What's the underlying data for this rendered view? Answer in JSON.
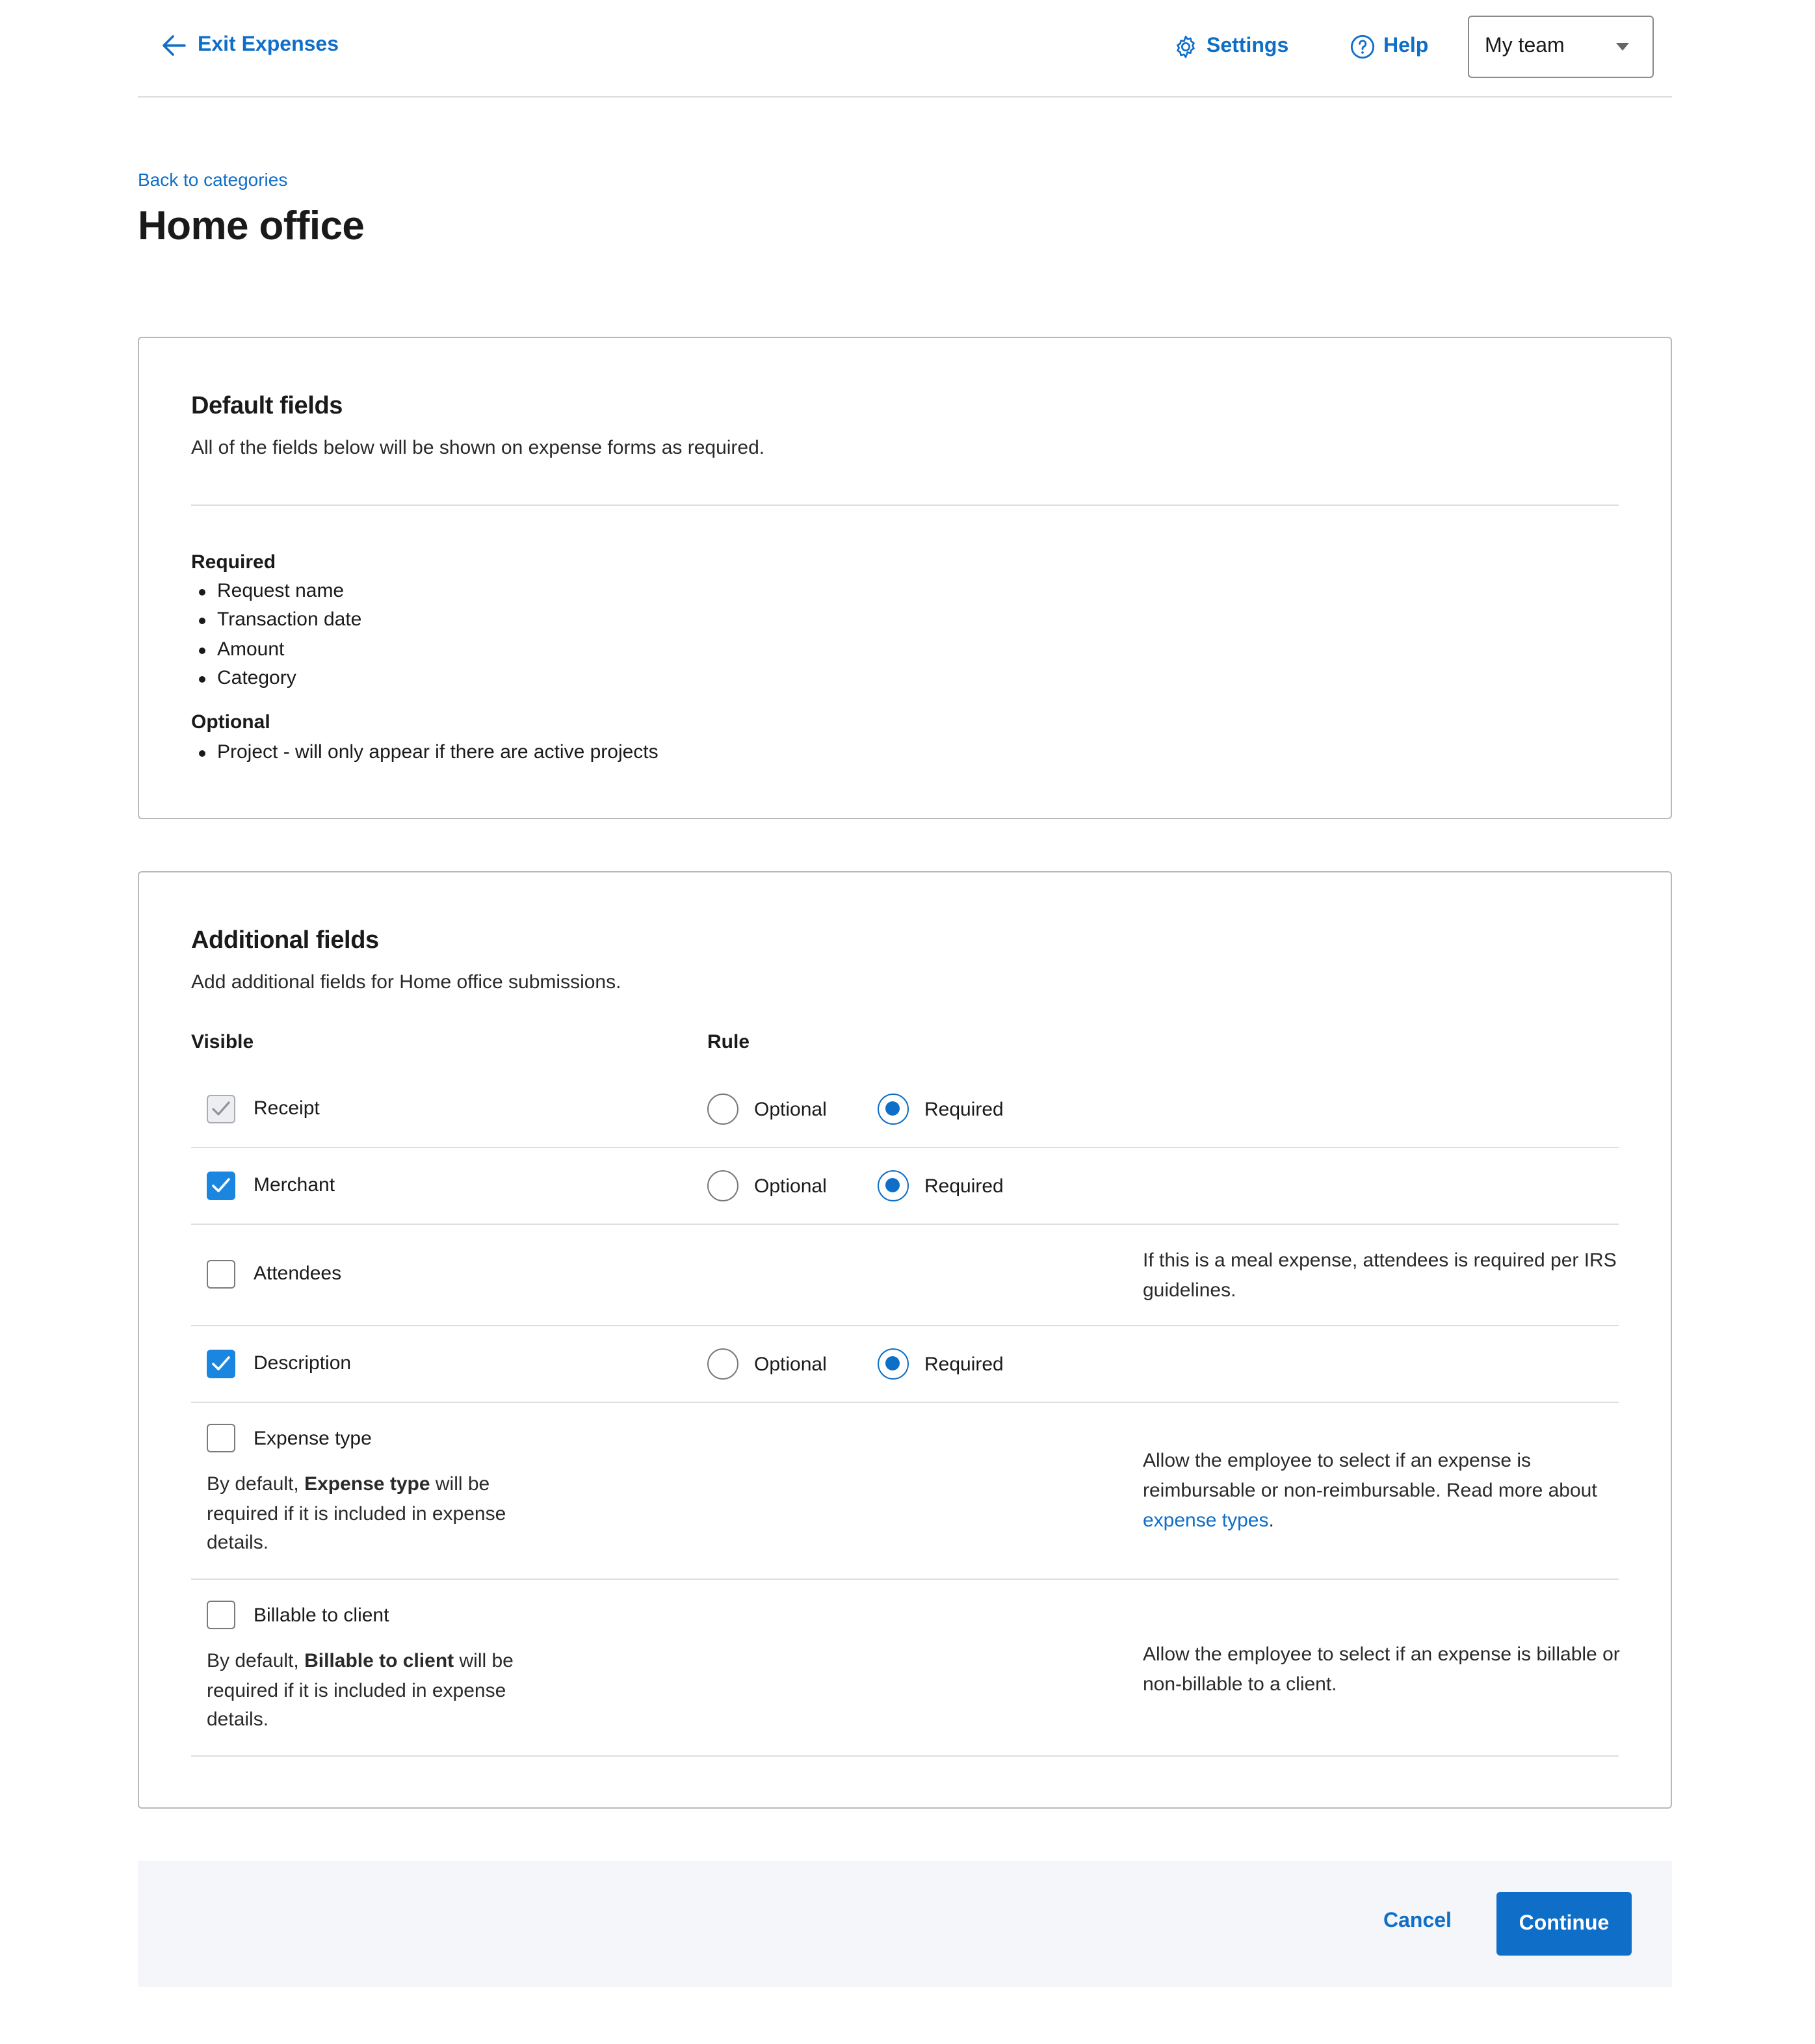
{
  "header": {
    "exit_label": "Exit Expenses",
    "settings_label": "Settings",
    "help_label": "Help",
    "team_select_value": "My team"
  },
  "page": {
    "back_link": "Back to categories",
    "title": "Home office"
  },
  "default_fields": {
    "title": "Default fields",
    "description": "All of the fields below will be shown on expense forms as required.",
    "required_title": "Required",
    "required_items": [
      "Request name",
      "Transaction date",
      "Amount",
      "Category"
    ],
    "optional_title": "Optional",
    "optional_items": [
      "Project - will only appear if there are active projects"
    ]
  },
  "additional_fields": {
    "title": "Additional fields",
    "description": "Add additional fields for Home office submissions.",
    "col_visible": "Visible",
    "col_rule": "Rule",
    "optional_label": "Optional",
    "required_label": "Required",
    "rows": [
      {
        "label": "Receipt",
        "visible": true,
        "disabled": true,
        "rule": "Required"
      },
      {
        "label": "Merchant",
        "visible": true,
        "disabled": false,
        "rule": "Required"
      },
      {
        "label": "Attendees",
        "visible": false,
        "disabled": false,
        "note": "If this is a meal expense, attendees is required per IRS guidelines."
      },
      {
        "label": "Description",
        "visible": true,
        "disabled": false,
        "rule": "Required"
      },
      {
        "label": "Expense type",
        "visible": false,
        "disabled": false,
        "sub_pre": "By default, ",
        "sub_bold": "Expense type",
        "sub_post": " will be required if it is included in expense details.",
        "note_pre": "Allow the employee to select if an expense is reimbursable or non-reimbursable. Read more about ",
        "note_link": "expense types",
        "note_post": "."
      },
      {
        "label": "Billable to client",
        "visible": false,
        "disabled": false,
        "sub_pre": "By default, ",
        "sub_bold": "Billable to client",
        "sub_post": " will be required if it is included in expense details.",
        "note": "Allow the employee to select if an expense is billable or non-billable to a client."
      }
    ]
  },
  "footer": {
    "cancel_label": "Cancel",
    "continue_label": "Continue"
  },
  "colors": {
    "accent": "#0e6ec8",
    "checkbox_checked": "#1a86e0",
    "footer_bg": "#f4f6f9"
  }
}
